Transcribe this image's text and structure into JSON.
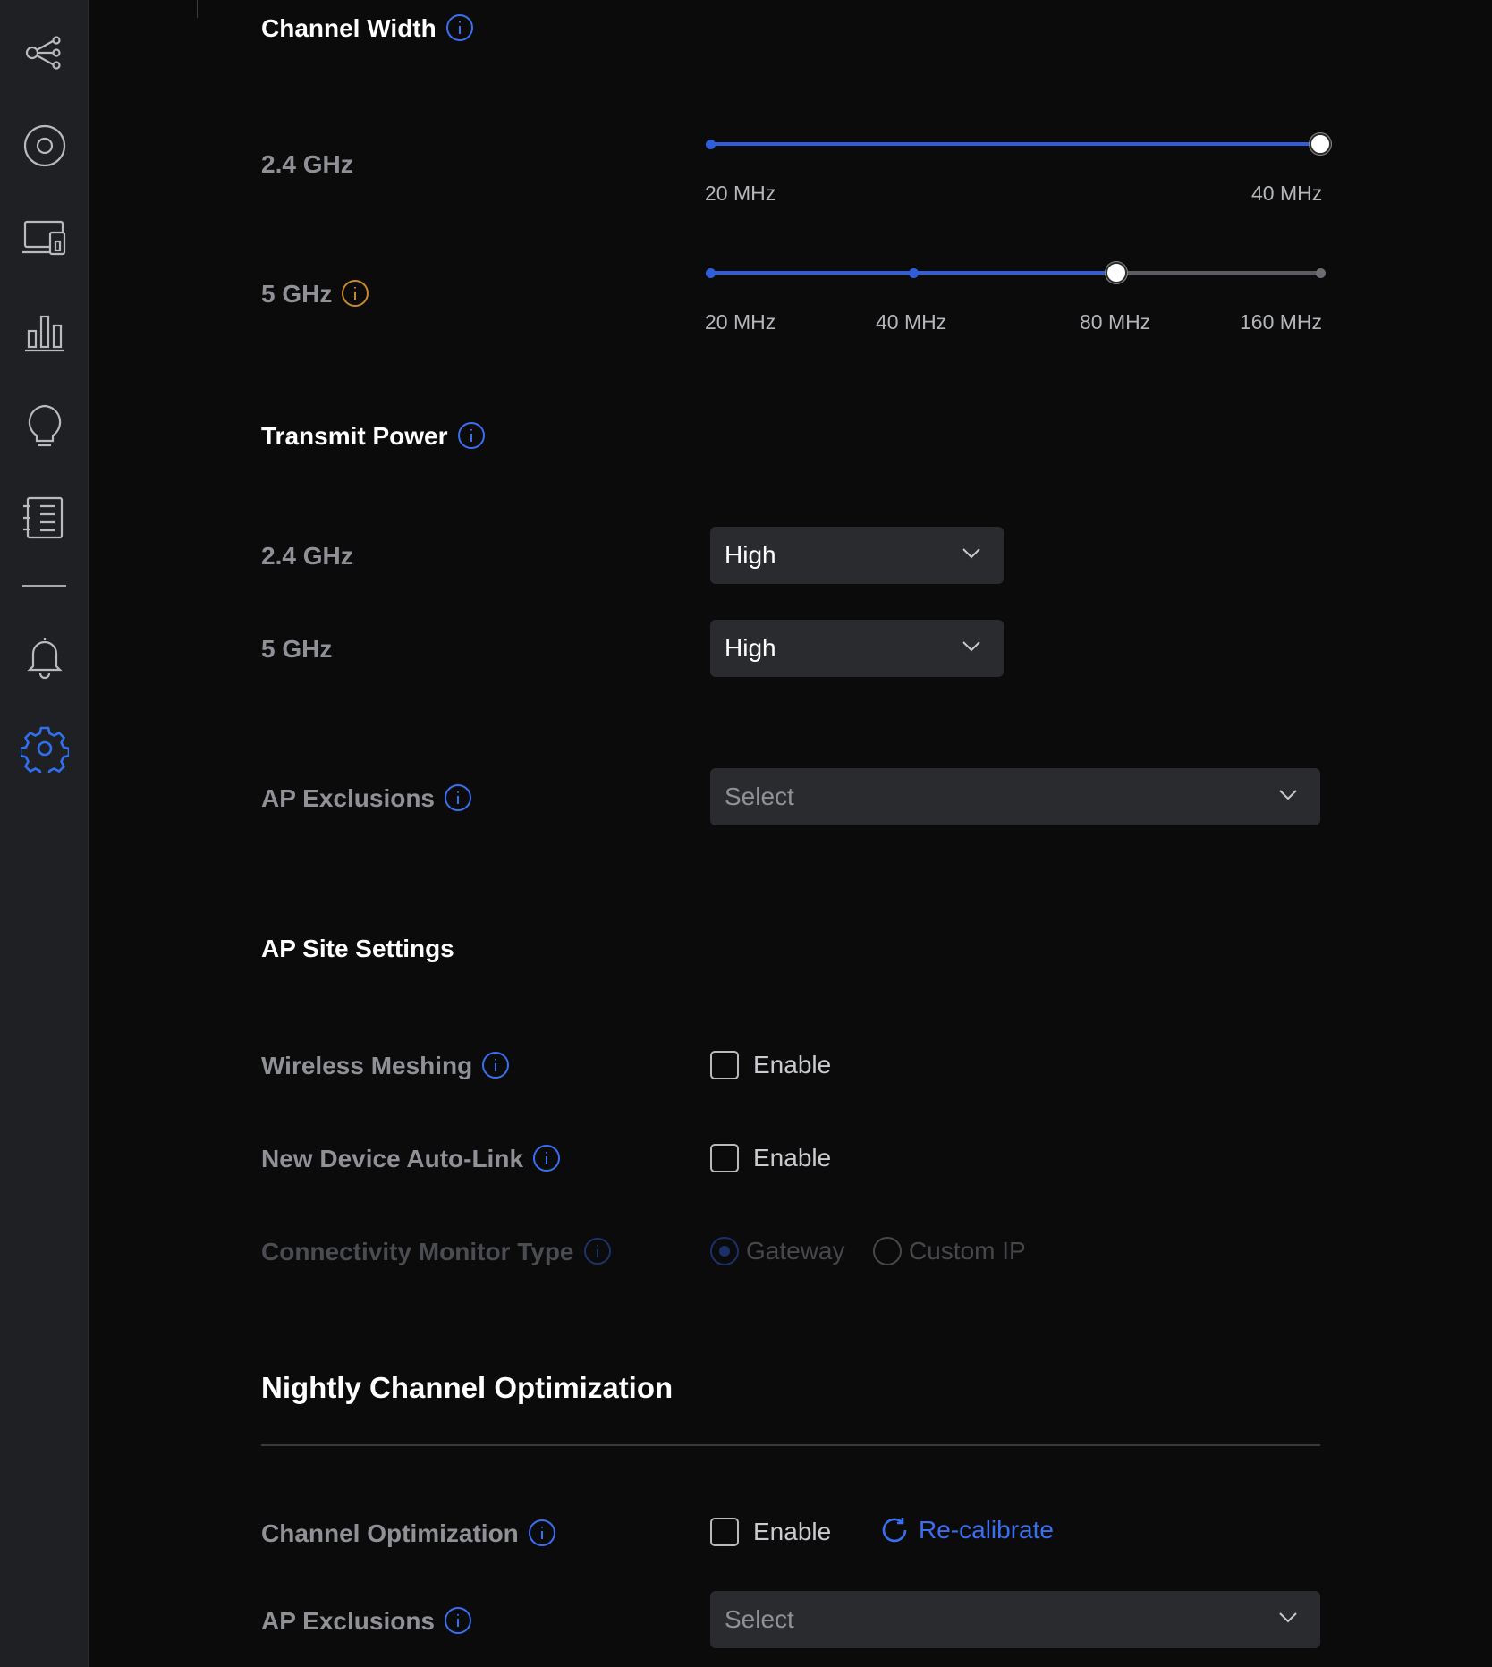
{
  "sidebar": {
    "items": [
      {
        "name": "topology-icon"
      },
      {
        "name": "target-icon"
      },
      {
        "name": "devices-icon"
      },
      {
        "name": "bar-chart-icon"
      },
      {
        "name": "lightbulb-icon"
      },
      {
        "name": "log-list-icon"
      },
      {
        "name": "bell-icon"
      },
      {
        "name": "gear-icon",
        "active": true
      }
    ]
  },
  "channel_width": {
    "title": "Channel Width",
    "band24": {
      "label": "2.4 GHz",
      "ticks": [
        "20 MHz",
        "40 MHz"
      ],
      "selected": "40 MHz"
    },
    "band5": {
      "label": "5 GHz",
      "ticks": [
        "20 MHz",
        "40 MHz",
        "80 MHz",
        "160 MHz"
      ],
      "selected": "80 MHz"
    }
  },
  "transmit_power": {
    "title": "Transmit Power",
    "band24": {
      "label": "2.4 GHz",
      "value": "High"
    },
    "band5": {
      "label": "5 GHz",
      "value": "High"
    }
  },
  "ap_exclusions_1": {
    "label": "AP Exclusions",
    "placeholder": "Select"
  },
  "ap_site_settings": {
    "title": "AP Site Settings",
    "wireless_meshing": {
      "label": "Wireless Meshing",
      "checkbox_label": "Enable",
      "checked": false
    },
    "auto_link": {
      "label": "New Device Auto-Link",
      "checkbox_label": "Enable",
      "checked": false
    },
    "monitor_type": {
      "label": "Connectivity Monitor Type",
      "options": [
        "Gateway",
        "Custom IP"
      ],
      "selected": "Gateway",
      "disabled": true
    }
  },
  "nightly": {
    "title": "Nightly Channel Optimization",
    "channel_opt": {
      "label": "Channel Optimization",
      "checkbox_label": "Enable",
      "checked": false,
      "recalibrate_label": "Re-calibrate"
    },
    "ap_exclusions": {
      "label": "AP Exclusions",
      "placeholder": "Select"
    }
  },
  "colors": {
    "accent": "#2f5ed9",
    "info_blue": "#3a6ff2",
    "info_orange": "#c9892b",
    "background": "#0b0b0c",
    "sidebar": "#1f2023"
  }
}
